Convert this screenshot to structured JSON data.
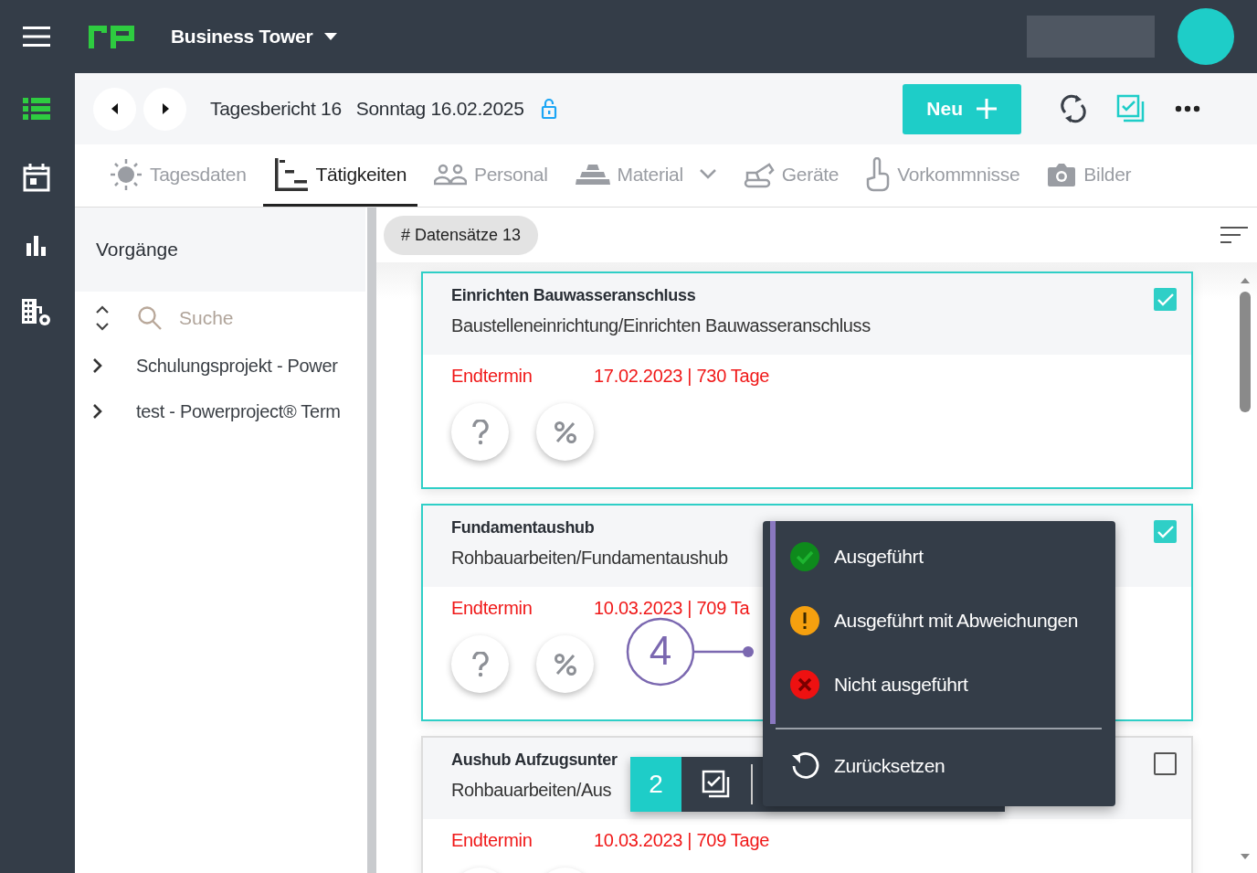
{
  "app_bar": {
    "project": "Business Tower"
  },
  "rail": [
    {
      "kind": "list",
      "selected": true
    },
    {
      "kind": "calendar",
      "selected": false
    },
    {
      "kind": "chart",
      "selected": false
    },
    {
      "kind": "building",
      "selected": false
    }
  ],
  "toolbar": {
    "report": "Tagesbericht 16",
    "date": "Sonntag 16.02.2025",
    "new_button": "Neu"
  },
  "tabs": [
    {
      "kind": "sun",
      "label": "Tagesdaten",
      "selected": false,
      "dropdown": false
    },
    {
      "kind": "gantt",
      "label": "Tätigkeiten",
      "selected": true,
      "dropdown": false
    },
    {
      "kind": "people",
      "label": "Personal",
      "selected": false,
      "dropdown": false
    },
    {
      "kind": "bricks",
      "label": "Material",
      "selected": false,
      "dropdown": true
    },
    {
      "kind": "excavator",
      "label": "Geräte",
      "selected": false,
      "dropdown": false
    },
    {
      "kind": "finger",
      "label": "Vorkommnisse",
      "selected": false,
      "dropdown": false
    },
    {
      "kind": "camera",
      "label": "Bilder",
      "selected": false,
      "dropdown": false
    }
  ],
  "sidebar": {
    "title": "Vorgänge",
    "search_placeholder": "Suche",
    "items": [
      {
        "label": "Schulungsprojekt - Power",
        "expanded": false
      },
      {
        "label": "test - Powerproject® Term",
        "expanded": false
      }
    ]
  },
  "list": {
    "count_badge": "# Datensätze 13",
    "cards": [
      {
        "title": "Einrichten Bauwasseranschluss",
        "path": "Baustelleneinrichtung/Einrichten Bauwasseranschluss",
        "due_label": "Endtermin",
        "due_value": "17.02.2023 | 730 Tage",
        "checked": true
      },
      {
        "title": "Fundamentaushub",
        "path": "Rohbauarbeiten/Fundamentaushub",
        "due_label": "Endtermin",
        "due_value": "10.03.2023 | 709 Ta",
        "checked": true
      },
      {
        "title": "Aushub Aufzugsunter",
        "path": "Rohbauarbeiten/Aus",
        "due_label": "Endtermin",
        "due_value": "10.03.2023 | 709 Tage",
        "checked": false
      }
    ]
  },
  "status_menu": {
    "items": [
      {
        "kind": "done",
        "label": "Ausgeführt"
      },
      {
        "kind": "warning",
        "label": "Ausgeführt mit Abweichungen"
      },
      {
        "kind": "failed",
        "label": "Nicht ausgeführt"
      },
      {
        "kind": "reset",
        "label": "Zurücksetzen"
      }
    ]
  },
  "selection_bar": {
    "count": "2"
  },
  "callout": {
    "number": "4"
  }
}
